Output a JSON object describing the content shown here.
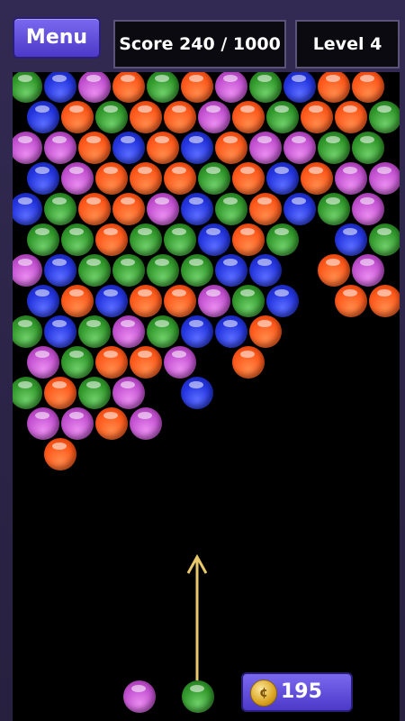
{
  "header": {
    "menu_label": "Menu",
    "score_label": "Score 240 / 1000",
    "level_label": "Level 4"
  },
  "colors": {
    "red": "#ff5a1c",
    "blue": "#2435e0",
    "green": "#329a2c",
    "purple": "#c452d2",
    "button": "#5b4ad6",
    "aim_arrow": "#e8c86a"
  },
  "board": {
    "rows": [
      [
        "green",
        "blue",
        "purple",
        "red",
        "green",
        "red",
        "purple",
        "green",
        "blue",
        "red",
        "red"
      ],
      [
        "blue",
        "red",
        "green",
        "red",
        "red",
        "purple",
        "red",
        "green",
        "red",
        "red",
        "green"
      ],
      [
        "purple",
        "purple",
        "red",
        "blue",
        "red",
        "blue",
        "red",
        "purple",
        "purple",
        "green",
        "green"
      ],
      [
        "blue",
        "purple",
        "red",
        "red",
        "red",
        "green",
        "red",
        "blue",
        "red",
        "purple",
        "purple"
      ],
      [
        "blue",
        "green",
        "red",
        "red",
        "purple",
        "blue",
        "green",
        "red",
        "blue",
        "green",
        "purple"
      ],
      [
        "green",
        "green",
        "red",
        "green",
        "green",
        "blue",
        "red",
        "green",
        null,
        "blue",
        "green"
      ],
      [
        "purple",
        "blue",
        "green",
        "green",
        "green",
        "green",
        "blue",
        "blue",
        null,
        "red",
        "purple"
      ],
      [
        "blue",
        "red",
        "blue",
        "red",
        "red",
        "purple",
        "green",
        "blue",
        null,
        "red",
        "red"
      ],
      [
        "green",
        "blue",
        "green",
        "purple",
        "green",
        "blue",
        "blue",
        "red"
      ],
      [
        "purple",
        "green",
        "red",
        "red",
        "purple",
        null,
        "red"
      ],
      [
        "green",
        "red",
        "green",
        "purple",
        null,
        "blue"
      ],
      [
        "purple",
        "purple",
        "red",
        "purple"
      ],
      [
        null,
        "red"
      ]
    ]
  },
  "shooter": {
    "current_bubble": "green",
    "next_bubble": "purple"
  },
  "coins": {
    "count": "195",
    "icon": "coin-icon"
  }
}
